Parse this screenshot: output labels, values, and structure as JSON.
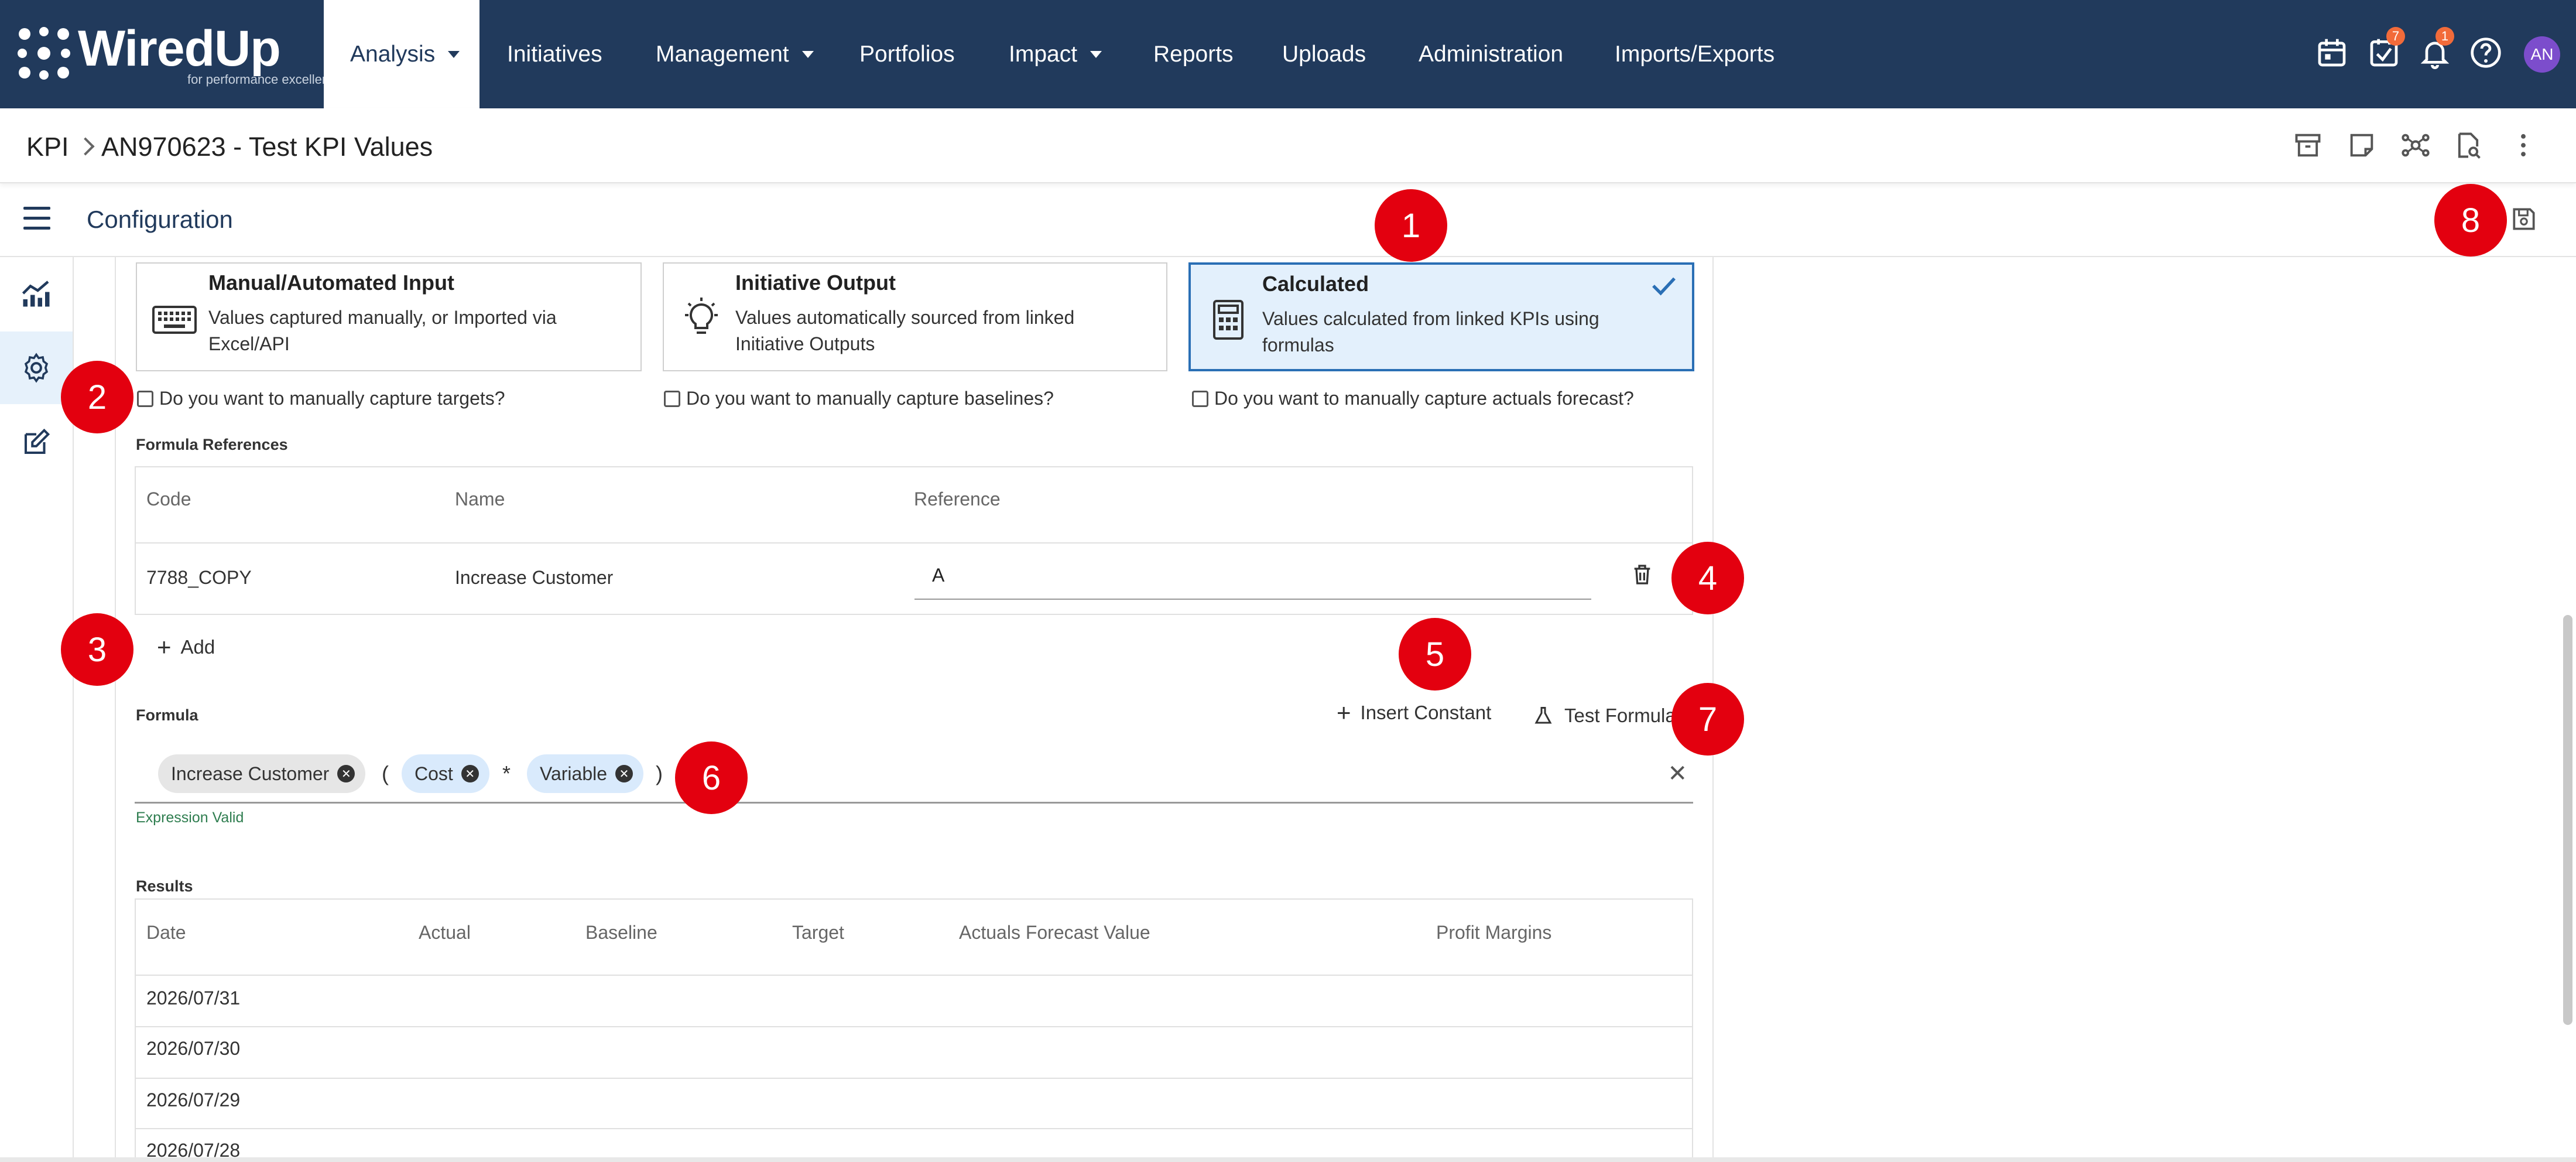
{
  "app": {
    "logo_text": "WiredUp",
    "logo_tagline": "for performance excellence"
  },
  "nav": {
    "items": [
      {
        "label": "Analysis",
        "dropdown": true,
        "active": true
      },
      {
        "label": "Initiatives",
        "dropdown": false
      },
      {
        "label": "Management",
        "dropdown": true
      },
      {
        "label": "Portfolios",
        "dropdown": false
      },
      {
        "label": "Impact",
        "dropdown": true
      },
      {
        "label": "Reports",
        "dropdown": false
      },
      {
        "label": "Uploads",
        "dropdown": false
      },
      {
        "label": "Administration",
        "dropdown": false
      },
      {
        "label": "Imports/Exports",
        "dropdown": false
      }
    ],
    "tasks_badge": "7",
    "notifications_badge": "1",
    "user_initials": "AN"
  },
  "breadcrumb": {
    "root": "KPI",
    "current": "AN970623 - Test KPI Values"
  },
  "config": {
    "title": "Configuration"
  },
  "cards": [
    {
      "title": "Manual/Automated Input",
      "description": "Values captured manually, or Imported via Excel/API",
      "selected": false
    },
    {
      "title": "Initiative Output",
      "description": "Values automatically sourced from linked Initiative Outputs",
      "selected": false
    },
    {
      "title": "Calculated",
      "description": "Values calculated from linked KPIs using formulas",
      "selected": true
    }
  ],
  "checkboxes": [
    {
      "label": "Do you want to manually capture targets?",
      "checked": false
    },
    {
      "label": "Do you want to manually capture baselines?",
      "checked": false
    },
    {
      "label": "Do you want to manually capture actuals forecast?",
      "checked": false
    }
  ],
  "formula_references": {
    "label": "Formula References",
    "columns": [
      "Code",
      "Name",
      "Reference"
    ],
    "rows": [
      {
        "code": "7788_COPY",
        "name": "Increase Customer",
        "reference": "A"
      }
    ],
    "add_label": "Add"
  },
  "formula": {
    "label": "Formula",
    "insert_constant_label": "Insert Constant",
    "test_formula_label": "Test Formula",
    "tokens": {
      "t1": "Increase Customer",
      "open": "(",
      "t2": "Cost",
      "mult": "*",
      "t3": "Variable",
      "close": ")"
    },
    "status": "Expression Valid"
  },
  "results": {
    "label": "Results",
    "columns": [
      "Date",
      "Actual",
      "Baseline",
      "Target",
      "Actuals Forecast Value",
      "Profit Margins"
    ],
    "rows": [
      "2026/07/31",
      "2026/07/30",
      "2026/07/29",
      "2026/07/28"
    ]
  },
  "markers": [
    "1",
    "2",
    "3",
    "4",
    "5",
    "6",
    "7",
    "8"
  ],
  "colors": {
    "nav_bg": "#213a5c",
    "accent": "#2a6fb5",
    "marker": "#e3000f",
    "badge": "#f26b3a",
    "valid": "#2e7d4f"
  }
}
